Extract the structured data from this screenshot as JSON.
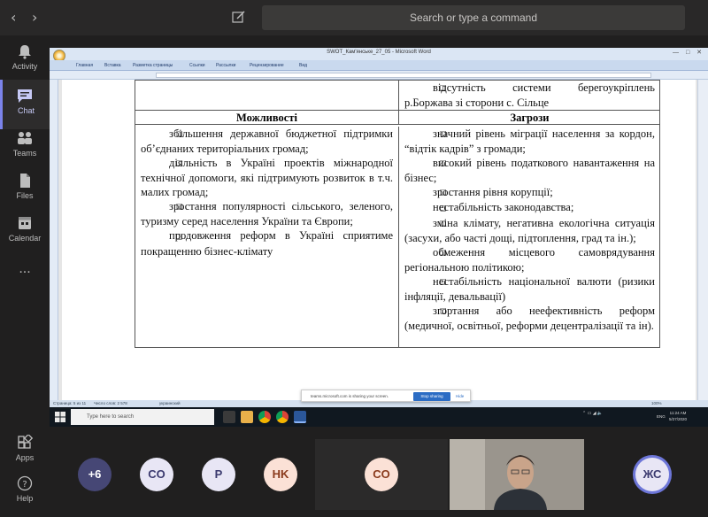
{
  "teams": {
    "search_placeholder": "Search or type a command",
    "rail": [
      {
        "label": "Activity",
        "icon": "bell-icon"
      },
      {
        "label": "Chat",
        "icon": "chat-icon"
      },
      {
        "label": "Teams",
        "icon": "teams-icon"
      },
      {
        "label": "Files",
        "icon": "files-icon"
      },
      {
        "label": "Calendar",
        "icon": "calendar-icon"
      },
      {
        "label": "...",
        "icon": "more-icon"
      },
      {
        "label": "Apps",
        "icon": "apps-icon"
      },
      {
        "label": "Help",
        "icon": "help-icon"
      }
    ],
    "participants": [
      {
        "initials": "+6",
        "bg": "#464775",
        "fg": "#ffffff"
      },
      {
        "initials": "CO",
        "bg": "#e8e6f5",
        "fg": "#3b3a6f"
      },
      {
        "initials": "P",
        "bg": "#e8e6f5",
        "fg": "#3b3a6f"
      },
      {
        "initials": "HK",
        "bg": "#fbe1d6",
        "fg": "#8a3a1c"
      },
      {
        "initials": "CO",
        "bg": "#fbe1d6",
        "fg": "#8a3a1c"
      },
      {
        "initials": "ЖС",
        "bg": "#e8e6f5",
        "fg": "#3b3a6f"
      }
    ],
    "accent": "#7b83eb"
  },
  "word": {
    "title": "SWOT_Кам'янське_27_05 - Microsoft Word",
    "ribbon_tabs": [
      "Главная",
      "Вставка",
      "Разметка страницы",
      "Ссылки",
      "Рассылки",
      "Рецензирование",
      "Вид"
    ],
    "status_page": "Страница: 5 из 11",
    "status_words": "Число слов: 2 578",
    "status_lang": "украинский",
    "zoom": "100%"
  },
  "table": {
    "top_right": "відсутність системи берегоукріплень р.Боржава зі сторони с. Сільце",
    "opportunities_header": "Можливості",
    "threats_header": "Загрози",
    "opportunities": [
      "збільшення державної бюджетної підтримки об’єднаних територіальних громад;",
      "діяльність в Україні проектів міжнародної технічної допомоги, які підтримують розвиток в т.ч. малих громад;",
      "зростання популярності сільського, зеленого, туризму серед населення України та Європи;",
      "продовження реформ в Україні сприятиме покращенню бізнес-клімату"
    ],
    "threats": [
      "значний рівень міграції населення за кордон, “відтік кадрів” з громади;",
      "високий рівень податкового навантаження на бізнес;",
      "зростання рівня корупції;",
      "нестабільність законодавства;",
      "зміна клімату, негативна екологічна ситуація (засухи, або часті дощі, підтоплення, град та ін.);",
      "обмеження місцевого самоврядування регіональною політикою;",
      "нестабільність національної валюти (ризики інфляції, девальвації)",
      "згортання або неефективність реформ (медичної, освітньої, реформи децентралізації та ін)."
    ]
  },
  "sharing": {
    "message": "teams.microsoft.com is sharing your screen.",
    "stop_label": "Stop sharing",
    "hide_label": "Hide"
  },
  "windows": {
    "search_placeholder": "Type here to search",
    "lang": "ENG",
    "time": "11:24 AM",
    "date": "5/27/2020"
  }
}
